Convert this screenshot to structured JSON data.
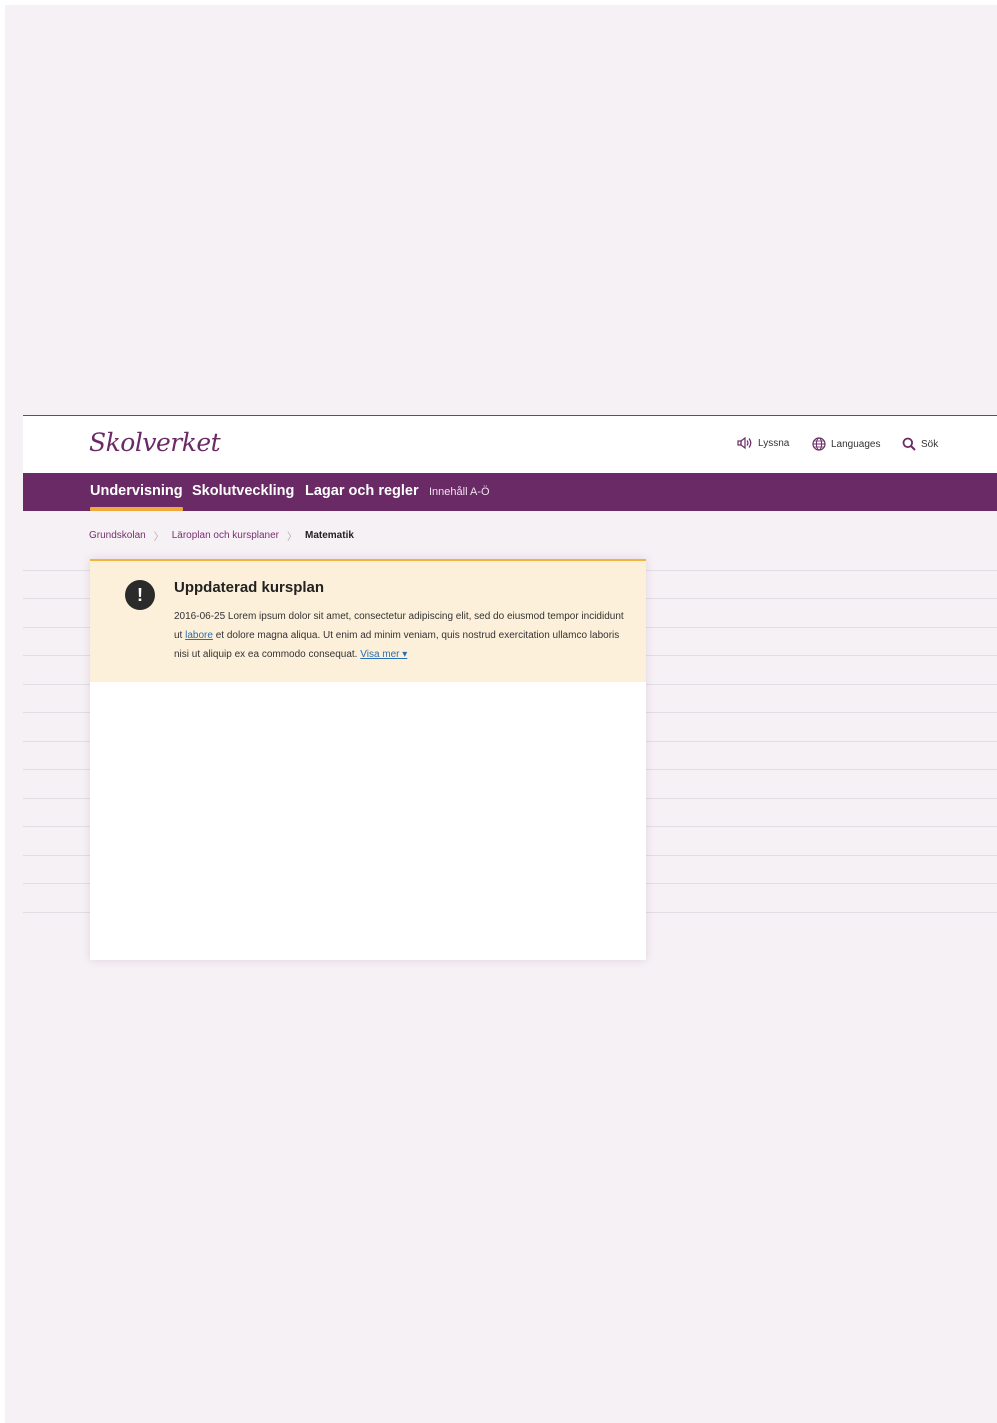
{
  "header": {
    "logo": "Skolverket",
    "listen_label": "Lyssna",
    "languages_label": "Languages",
    "search_label": "Sök"
  },
  "nav": {
    "items": [
      {
        "label": "Undervisning"
      },
      {
        "label": "Skolutveckling"
      },
      {
        "label": "Lagar och regler"
      },
      {
        "label": "Innehåll A-Ö"
      }
    ]
  },
  "breadcrumb": {
    "items": [
      {
        "label": "Grundskolan"
      },
      {
        "label": "Läroplan och kursplaner"
      },
      {
        "label": "Matematik"
      }
    ]
  },
  "notice": {
    "icon": "!",
    "title": "Uppdaterad kursplan",
    "text_before": "2016-06-25 Lorem ipsum dolor sit amet, consectetur adipiscing elit, sed do eiusmod tempor incididunt ut ",
    "link_labore": "labore",
    "text_after": " et dolore magna aliqua. Ut enim ad minim veniam, quis nostrud exercitation ullamco laboris nisi ut aliquip ex ea commodo consequat. ",
    "link_more": "Visa mer ▾"
  },
  "colors": {
    "brand": "#6a2a65",
    "accent": "#f2a93b",
    "notice_bg": "#fdf0da",
    "link": "#2a6fb0"
  }
}
